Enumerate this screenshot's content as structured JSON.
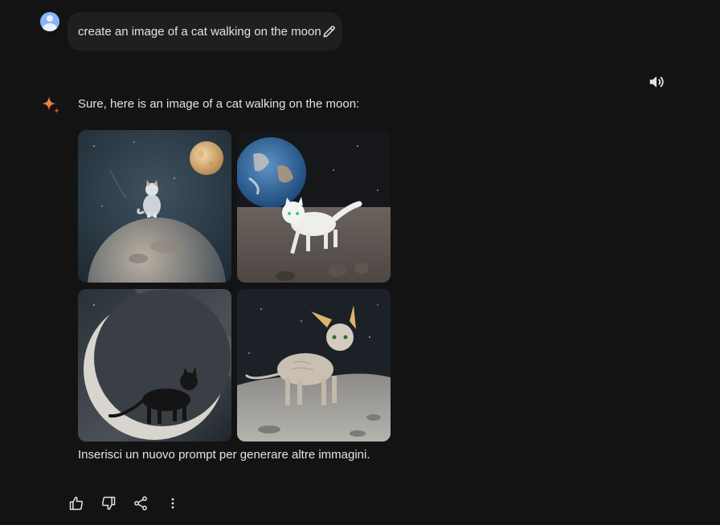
{
  "user_turn": {
    "prompt": "create an image of a cat walking on the moon",
    "avatar_icon": "user-avatar-icon",
    "edit_icon": "pencil-icon"
  },
  "header": {
    "speaker_icon": "speaker-icon"
  },
  "model_turn": {
    "logo_icon": "sparkle-icon",
    "response": "Sure, here is an image of a cat walking on the moon:",
    "images": [
      {
        "subject": "grey cat sitting on a planet with a full moon behind"
      },
      {
        "subject": "white cat walking on lunar surface with Earth behind"
      },
      {
        "subject": "black cat walking along a crescent moon"
      },
      {
        "subject": "sphynx cat standing on the lunar surface"
      }
    ],
    "followup": "Inserisci un nuovo prompt per generare altre immagini."
  },
  "actions": [
    {
      "name": "thumbs-up-icon"
    },
    {
      "name": "thumbs-down-icon"
    },
    {
      "name": "share-icon"
    },
    {
      "name": "more-vertical-icon"
    }
  ],
  "colors": {
    "background": "#131314",
    "bubble": "#1e1f20",
    "text": "#e3e3e3",
    "accent_blue": "#8ab4f8",
    "spark_orange": "#f28b54",
    "spark_red": "#e8453c"
  }
}
